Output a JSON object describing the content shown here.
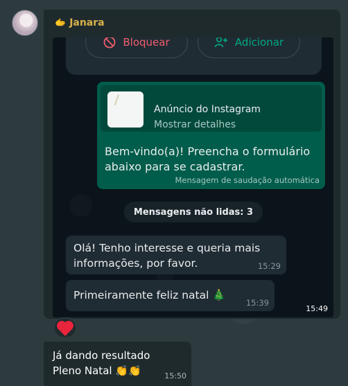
{
  "sender": {
    "name": "Janara",
    "badge_icon": "hand-icon"
  },
  "screenshot": {
    "actions": {
      "block_label": "Bloquear",
      "add_label": "Adicionar"
    },
    "ad": {
      "title": "Anúncio do Instagram",
      "subtitle": "Mostrar detalhes",
      "body": "Bem-vindo(a)! Preencha o formulário abaixo para se cadastrar.",
      "footer": "Mensagem de saudação automática"
    },
    "unread_label": "Mensagens não lidas: 3",
    "messages": [
      {
        "text": "Olá! Tenho interesse e queria mais informações, por favor.",
        "time": "15:29"
      },
      {
        "text": "Primeiramente feliz natal 🎄",
        "time": "15:39"
      }
    ],
    "time": "15:49"
  },
  "reaction": {
    "emoji": "heart"
  },
  "message": {
    "text_line1": "Já dando resultado",
    "text_line2": "Pleno Natal 👏👏",
    "time": "15:50"
  },
  "colors": {
    "accent_green": "#00a884",
    "block_red": "#f15c6d",
    "sender_gold": "#d7b14a"
  }
}
